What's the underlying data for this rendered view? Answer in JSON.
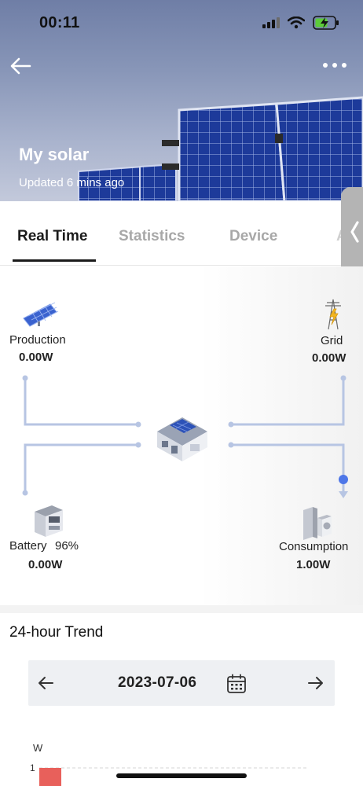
{
  "status_bar": {
    "time": "00:11"
  },
  "header": {
    "title": "My solar",
    "subtitle": "Updated 6 mins ago"
  },
  "tabs": [
    {
      "label": "Real Time",
      "active": true
    },
    {
      "label": "Statistics",
      "active": false
    },
    {
      "label": "Device",
      "active": false
    },
    {
      "label": "A",
      "active": false
    }
  ],
  "flow": {
    "production": {
      "label": "Production",
      "value": "0.00W"
    },
    "grid": {
      "label": "Grid",
      "value": "0.00W"
    },
    "battery": {
      "label": "Battery",
      "percent": "96%",
      "value": "0.00W"
    },
    "consumption": {
      "label": "Consumption",
      "value": "1.00W"
    }
  },
  "trend": {
    "title": "24-hour Trend",
    "date": "2023-07-06",
    "unit": "W",
    "y_tick": "1"
  },
  "colors": {
    "flow_line": "#b7c5e3",
    "flow_dot": "#4d76e8",
    "accent_bar": "#e8605b",
    "tab_active": "#1b1b1b",
    "tab_inactive": "#a8a8a8"
  },
  "chart_data": {
    "type": "bar",
    "title": "24-hour Trend",
    "ylabel": "W",
    "y_ticks": [
      "1"
    ],
    "series": [
      {
        "values": [
          1
        ]
      }
    ],
    "ylim": [
      0,
      1
    ]
  }
}
